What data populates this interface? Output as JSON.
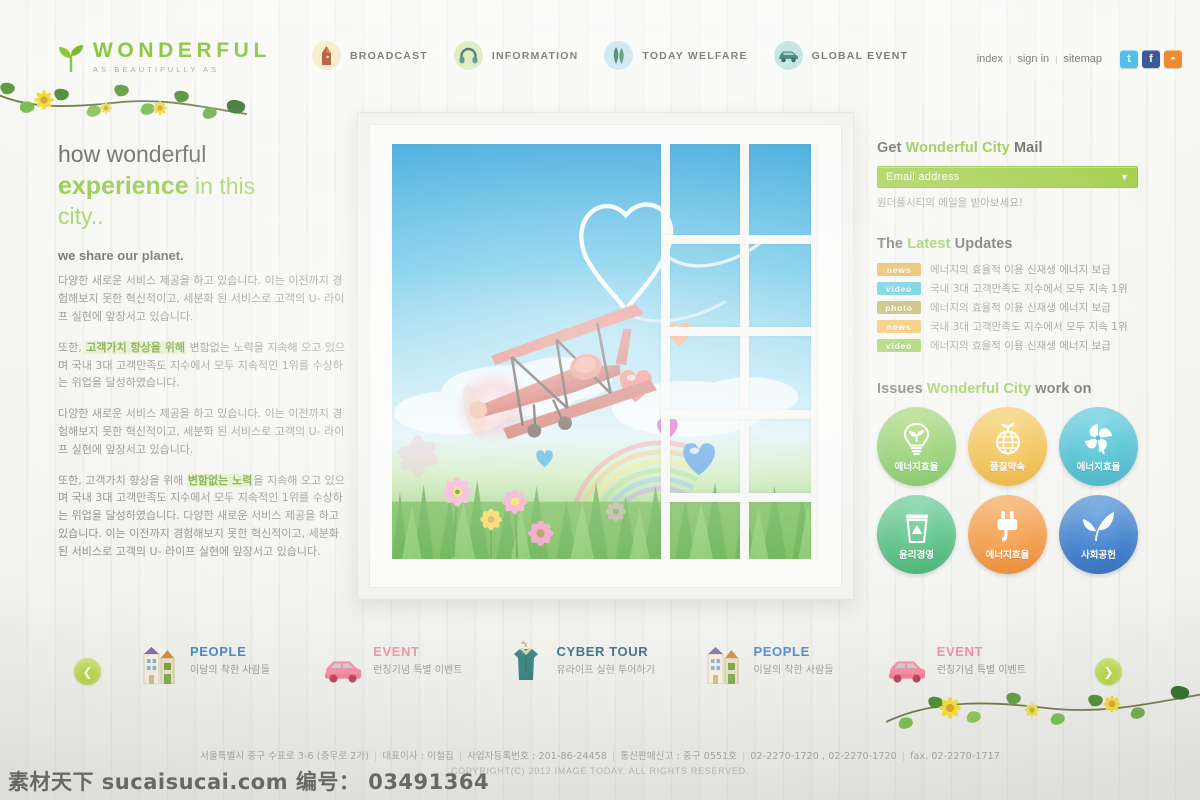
{
  "brand": {
    "word": "WONDERFUL",
    "tagline": "AS BEAUTIFULLY AS",
    "logo_icon": "sprout-icon",
    "green": "#8cc63e"
  },
  "nav": {
    "items": [
      {
        "label": "BROADCAST",
        "icon": "megaphone-icon",
        "bubble": "#f6ecc8"
      },
      {
        "label": "INFORMATION",
        "icon": "headphones-icon",
        "bubble": "#dceabb"
      },
      {
        "label": "TODAY WELFARE",
        "icon": "leaves-icon",
        "bubble": "#c9e6f0"
      },
      {
        "label": "GLOBAL EVENT",
        "icon": "car-icon",
        "bubble": "#bfe3dd"
      }
    ]
  },
  "util": {
    "links": [
      "index",
      "sign in",
      "sitemap"
    ],
    "separator": "|",
    "social": [
      {
        "name": "twitter-icon",
        "glyph": "t",
        "color": "#4fc0e8"
      },
      {
        "name": "facebook-icon",
        "glyph": "f",
        "color": "#3b5998"
      },
      {
        "name": "rss-icon",
        "glyph": "◔",
        "color": "#ef8b2c"
      }
    ]
  },
  "hero": {
    "headline_line1": "how wonderful",
    "headline_em": "experience",
    "headline_rest": " in this",
    "headline_line3": "city..",
    "subhead": "we share our planet.",
    "paragraph1": "다양한 새로운 서비스 제공을 하고 있습니다. 이는 이전까지 경험해보지 못한 혁신적이고, 세분화 된 서비스로 고객의 U- 라이프 실현에 앞장서고 있습니다.",
    "paragraph2_pre": "또한, ",
    "paragraph2_hl": "고객가치 향상을 위해",
    "paragraph2_post": " 변함없는 노력을 지속해 오고 있으며 국내 3대 고객만족도 지수에서 모두 지속적인 1위를 수상하는 위업을 달성하였습니다.",
    "paragraph3": "다양한 새로운 서비스 제공을 하고 있습니다. 이는 이전까지 경험해보지 못한 혁신적이고, 세분화 된 서비스로 고객의 U- 라이프 실현에 앞장서고 있습니다.",
    "paragraph4_pre": "또한, 고객가치 향상을 위해 ",
    "paragraph4_hl": "변함없는 노력",
    "paragraph4_post": "을 지속해 오고 있으며 국내 3대 고객만족도 지수에서 모두 지속적인 1위를 수상하는 위업을 달성하였습니다. 다양한 새로운 서비스 제공을 하고 있습니다. 이는 이전까지 경험해보지 못한 혁신적이고, 세분화 된 서비스로 고객의 U- 라이프 실현에 앞장서고 있습니다.",
    "image_alt": "red biplane flying through an open white window over a blue sky with heart-shaped vapour trail, grass, cosmos flowers and a rainbow"
  },
  "mail": {
    "title_pre": "Get ",
    "title_accent": "Wonderful City",
    "title_post": " Mail",
    "placeholder": "Email address",
    "value": "Email address",
    "caret_icon": "chevron-down-icon",
    "note": "원더풀시티의 메일을 받아보세요!"
  },
  "updates": {
    "title_pre": "The ",
    "title_accent": "Latest",
    "title_post": " Updates",
    "items": [
      {
        "badge": "news",
        "badge_color": "#e5ab34",
        "text": "에너지의 효율적 이용 신재생 에너지 보급"
      },
      {
        "badge": "video",
        "badge_color": "#3ec1d6",
        "text": "국내 3대 고객만족도 지수에서 모두 지속 1위"
      },
      {
        "badge": "photo",
        "badge_color": "#b0a449",
        "text": "에너지의 효율적 이용 신재생 에너지 보급"
      },
      {
        "badge": "news",
        "badge_color": "#f0b63f",
        "text": "국내 3대 고객만족도 지수에서 모두 지속 1위"
      },
      {
        "badge": "video",
        "badge_color": "#8cc63e",
        "text": "에너지의 효율적 이용 신재생 에너지 보급"
      }
    ]
  },
  "issues": {
    "title_pre": "Issues ",
    "title_accent": "Wonderful City",
    "title_post": " work on",
    "items": [
      {
        "label": "에너지효율",
        "icon": "lightbulb-leaf-icon",
        "color": "#6cbe45",
        "color2": "#8ccf4e"
      },
      {
        "label": "품질약속",
        "icon": "globe-sprout-icon",
        "color": "#eeb02a",
        "color2": "#f3c14a"
      },
      {
        "label": "에너지효율",
        "icon": "pinwheel-icon",
        "color": "#34b4c8",
        "color2": "#4ec3d4"
      },
      {
        "label": "윤리경영",
        "icon": "recycle-bin-icon",
        "color": "#36b06a",
        "color2": "#4cc07d"
      },
      {
        "label": "에너지효율",
        "icon": "power-plug-icon",
        "color": "#ef8b2c",
        "color2": "#f59d44"
      },
      {
        "label": "사회공헌",
        "icon": "two-leaves-icon",
        "color": "#2f72c4",
        "color2": "#4187d4"
      }
    ]
  },
  "carousel": {
    "prev_icon": "chevron-left-icon",
    "next_icon": "chevron-right-icon",
    "items": [
      {
        "title": "PEOPLE",
        "sub": "이달의 착한 사람들",
        "color": "#4a86c8",
        "icon": "buildings-icon"
      },
      {
        "title": "EVENT",
        "sub": "런칭기념 특별 이벤트",
        "color": "#f28ca0",
        "icon": "car-icon"
      },
      {
        "title": "CYBER TOUR",
        "sub": "유라이프 실현 투어하기",
        "color": "#2d6a7a",
        "icon": "tshirt-hanger-icon"
      },
      {
        "title": "PEOPLE",
        "sub": "이달의 착한 사람들",
        "color": "#4a86c8",
        "icon": "buildings-icon"
      },
      {
        "title": "EVENT",
        "sub": "런칭기념 특별 이벤트",
        "color": "#f28ca0",
        "icon": "car-icon"
      }
    ]
  },
  "footer": {
    "address": "서울특별시 중구 수표로 3-6 (충무로 2가)",
    "ceo": "대표이사 : 이철집",
    "biz_no": "사업자등록번호 : 201-86-24458",
    "mailorder": "통신판매신고 : 중구 0551호",
    "phone": "02-2270-1720 , 02-2270-1720",
    "fax": "fax. 02-2270-1717",
    "copyright": "COPYRIGHT(C) 2012 IMAGE TODAY. ALL RIGHTS RESERVED."
  },
  "watermark": "素材天下 sucaisucai.com  编号： 03491364"
}
